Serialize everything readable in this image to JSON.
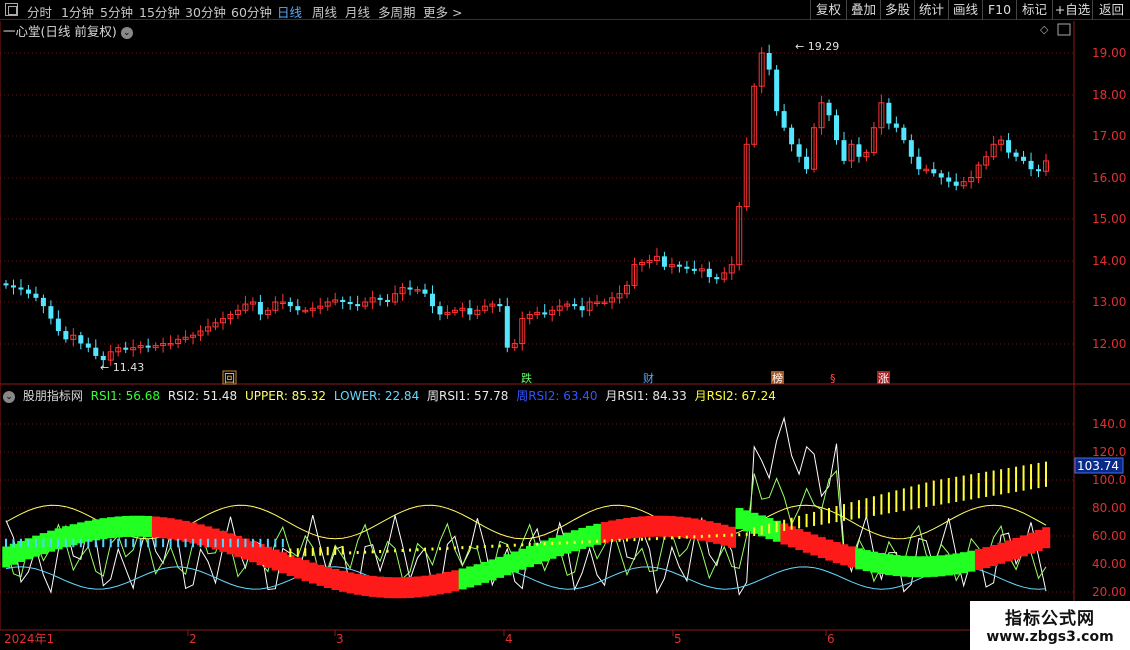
{
  "toolbar": {
    "timeframes": [
      "分时",
      "1分钟",
      "5分钟",
      "15分钟",
      "30分钟",
      "60分钟",
      "日线",
      "周线",
      "月线",
      "多周期",
      "更多"
    ],
    "active": "日线",
    "right_buttons": [
      "复权",
      "叠加",
      "多股",
      "统计",
      "画线",
      "F10",
      "标记",
      "+自选",
      "返回"
    ]
  },
  "price_panel": {
    "title": "一心堂(日线 前复权)",
    "axis_labels": [
      "19.00",
      "18.00",
      "17.00",
      "16.00",
      "15.00",
      "14.00",
      "13.00",
      "12.00"
    ],
    "high_label": "19.29",
    "low_label": "11.43",
    "event_markers": [
      "回",
      "跌",
      "财",
      "榜",
      "§",
      "涨"
    ]
  },
  "indicator_panel": {
    "name": "股朋指标网",
    "values": [
      {
        "label": "RSI1: 56.68",
        "color": "#33ff33"
      },
      {
        "label": "RSI2: 51.48",
        "color": "#e8e8e8"
      },
      {
        "label": "UPPER: 85.32",
        "color": "#ffff66"
      },
      {
        "label": "LOWER: 22.84",
        "color": "#66d9ff"
      },
      {
        "label": "周RSI1: 57.78",
        "color": "#e8e8e8"
      },
      {
        "label": "周RSI2: 63.40",
        "color": "#3355ff"
      },
      {
        "label": "月RSI1: 84.33",
        "color": "#e8e8e8"
      },
      {
        "label": "月RSI2: 67.24",
        "color": "#ffff33"
      }
    ],
    "axis_labels": [
      "140.0",
      "120.0",
      "100.0",
      "80.00",
      "60.00",
      "40.00",
      "20.00"
    ],
    "current_value": "103.74"
  },
  "date_axis": [
    "2024年1",
    "2",
    "3",
    "4",
    "5",
    "6"
  ],
  "watermark": {
    "title": "指标公式网",
    "url": "www.zbgs3.com"
  },
  "colors": {
    "up": "#ff3333",
    "down": "#55e6ff",
    "bg": "#000000",
    "grid": "#8b1a1a"
  }
}
